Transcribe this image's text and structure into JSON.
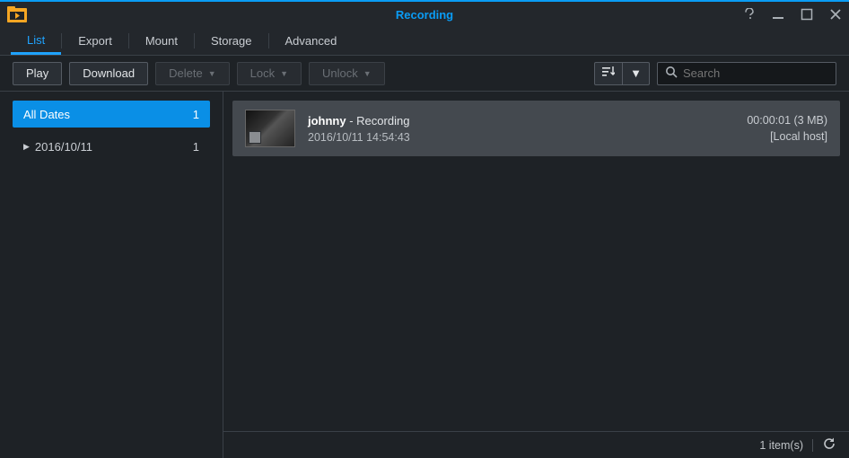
{
  "window_title": "Recording",
  "tabs": [
    "List",
    "Export",
    "Mount",
    "Storage",
    "Advanced"
  ],
  "active_tab_index": 0,
  "toolbar": {
    "play": "Play",
    "download": "Download",
    "delete": "Delete",
    "lock": "Lock",
    "unlock": "Unlock"
  },
  "search": {
    "placeholder": "Search"
  },
  "sidebar": {
    "all_dates": {
      "label": "All Dates",
      "count": "1"
    },
    "dates": [
      {
        "label": "2016/10/11",
        "count": "1"
      }
    ]
  },
  "recordings": [
    {
      "name": "johnny",
      "suffix": " - Recording",
      "timestamp": "2016/10/11 14:54:43",
      "duration_size": "00:00:01 (3 MB)",
      "host": "[Local host]"
    }
  ],
  "statusbar": {
    "items": "1 item(s)"
  }
}
